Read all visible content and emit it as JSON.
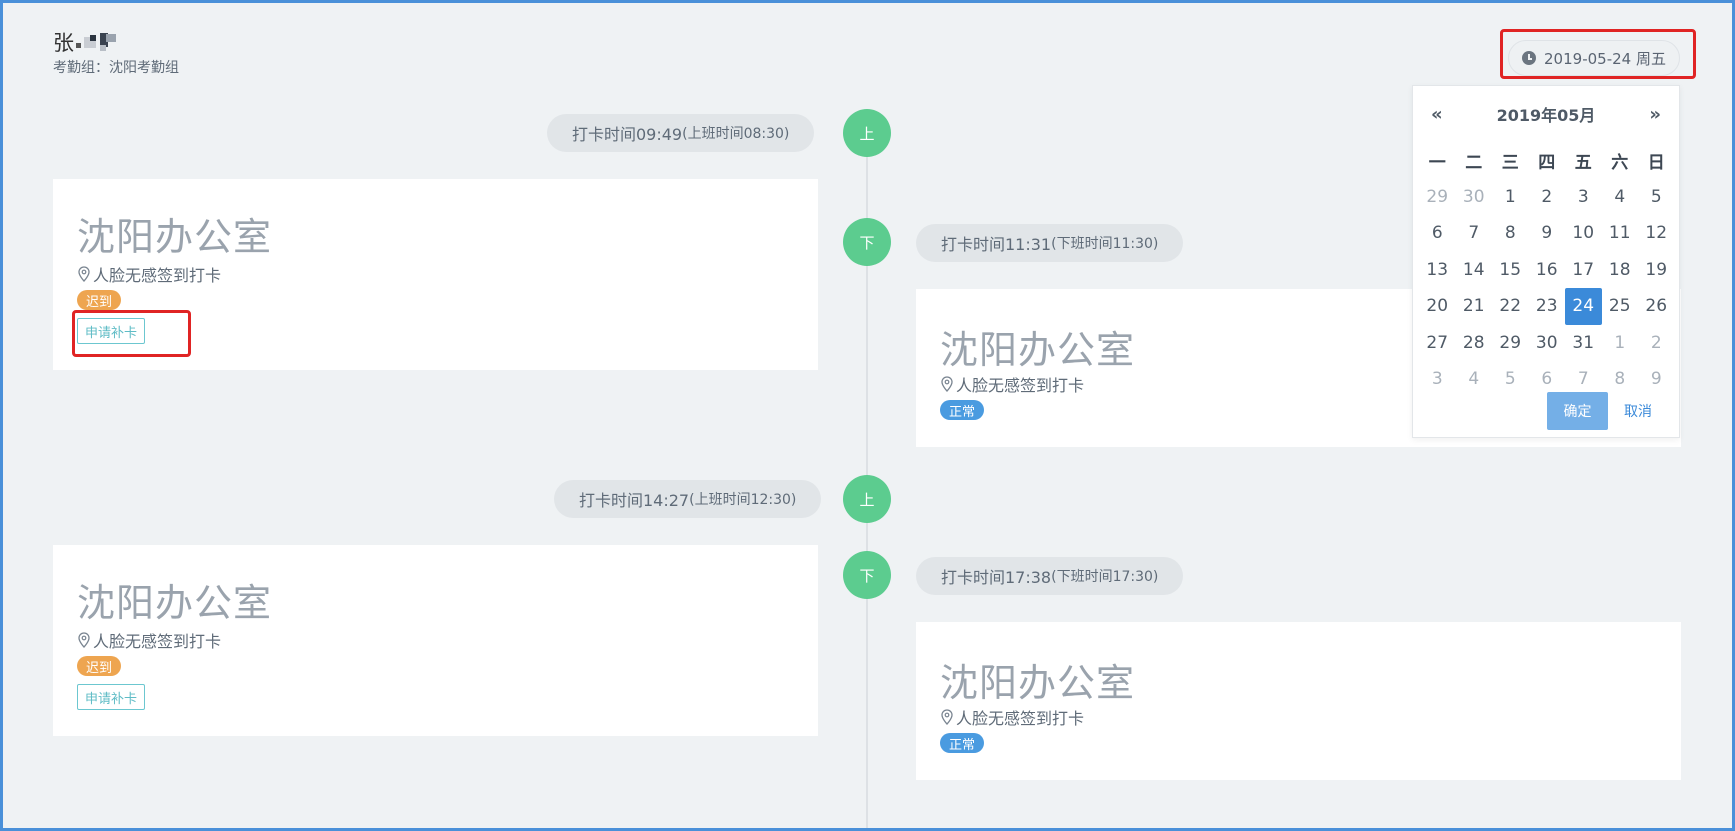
{
  "header": {
    "user_name": "张",
    "group_label": "考勤组：沈阳考勤组"
  },
  "date_picker": {
    "value": "2019-05-24 周五",
    "month_title": "2019年05月",
    "prev_label": "«",
    "next_label": "»",
    "weekdays": [
      "一",
      "二",
      "三",
      "四",
      "五",
      "六",
      "日"
    ],
    "days": [
      {
        "d": "29",
        "muted": true
      },
      {
        "d": "30",
        "muted": true
      },
      {
        "d": "1"
      },
      {
        "d": "2"
      },
      {
        "d": "3"
      },
      {
        "d": "4"
      },
      {
        "d": "5"
      },
      {
        "d": "6"
      },
      {
        "d": "7"
      },
      {
        "d": "8"
      },
      {
        "d": "9"
      },
      {
        "d": "10"
      },
      {
        "d": "11"
      },
      {
        "d": "12"
      },
      {
        "d": "13"
      },
      {
        "d": "14"
      },
      {
        "d": "15"
      },
      {
        "d": "16"
      },
      {
        "d": "17"
      },
      {
        "d": "18"
      },
      {
        "d": "19"
      },
      {
        "d": "20"
      },
      {
        "d": "21"
      },
      {
        "d": "22"
      },
      {
        "d": "23"
      },
      {
        "d": "24",
        "selected": true
      },
      {
        "d": "25"
      },
      {
        "d": "26"
      },
      {
        "d": "27"
      },
      {
        "d": "28"
      },
      {
        "d": "29"
      },
      {
        "d": "30"
      },
      {
        "d": "31"
      },
      {
        "d": "1",
        "muted": true
      },
      {
        "d": "2",
        "muted": true
      },
      {
        "d": "3",
        "muted": true
      },
      {
        "d": "4",
        "muted": true
      },
      {
        "d": "5",
        "muted": true
      },
      {
        "d": "6",
        "muted": true
      },
      {
        "d": "7",
        "muted": true
      },
      {
        "d": "8",
        "muted": true
      },
      {
        "d": "9",
        "muted": true
      }
    ],
    "confirm_label": "确定",
    "cancel_label": "取消"
  },
  "records": [
    {
      "node_label": "上",
      "punch_time": "打卡时间09:49",
      "scheduled": "(上班时间08:30)",
      "location": "沈阳办公室",
      "method": "人脸无感签到打卡",
      "status": "迟到",
      "action": "申请补卡"
    },
    {
      "node_label": "下",
      "punch_time": "打卡时间11:31",
      "scheduled": "(下班时间11:30)",
      "location": "沈阳办公室",
      "method": "人脸无感签到打卡",
      "status": "正常"
    },
    {
      "node_label": "上",
      "punch_time": "打卡时间14:27",
      "scheduled": "(上班时间12:30)",
      "location": "沈阳办公室",
      "method": "人脸无感签到打卡",
      "status": "迟到",
      "action": "申请补卡"
    },
    {
      "node_label": "下",
      "punch_time": "打卡时间17:38",
      "scheduled": "(下班时间17:30)",
      "location": "沈阳办公室",
      "method": "人脸无感签到打卡",
      "status": "正常"
    }
  ],
  "colors": {
    "node_green": "#5ccc8f",
    "late_orange": "#eea550",
    "normal_blue": "#4a9be0",
    "selected_blue": "#3b8ad9",
    "highlight_red": "#e02424"
  }
}
